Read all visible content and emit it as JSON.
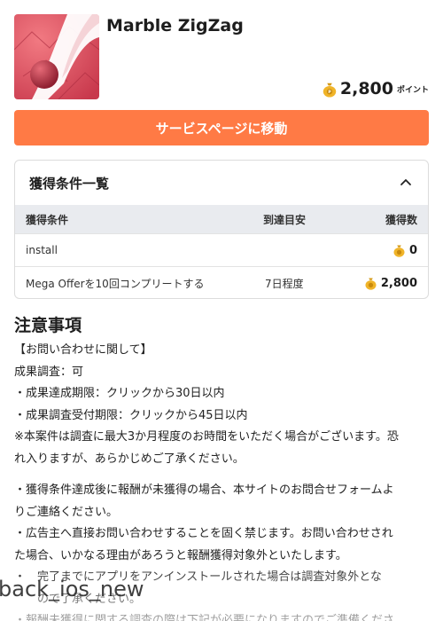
{
  "app": {
    "title": "Marble ZigZag",
    "icon_name": "marble-zigzag-app-icon",
    "points_value": "2,800",
    "points_unit": "ポイント"
  },
  "cta": {
    "label": "サービスページに移動"
  },
  "conditions": {
    "title": "獲得条件一覧",
    "headers": [
      "獲得条件",
      "到達目安",
      "獲得数"
    ],
    "rows": [
      {
        "condition": "install",
        "eta": "",
        "reward": "0"
      },
      {
        "condition": "Mega Offerを10回コンプリートする",
        "eta": "7日程度",
        "reward": "2,800"
      }
    ]
  },
  "notes": {
    "title": "注意事項",
    "lines": [
      "【お問い合わせに関して】",
      "成果調査：可",
      "・成果達成期限：クリックから30日以内",
      "・成果調査受付期限：クリックから45日以内",
      "※本案件は調査に最大3か月程度のお時間をいただく場合がございます。恐",
      "れ入りますが、あらかじめご了承ください。",
      "",
      "・獲得条件達成後に報酬が未獲得の場合、本サイトのお問合せフォームよ",
      "りご連絡ください。",
      "・広告主へ直接お問い合わせすることを固く禁じます。お問い合わせされ",
      "た場合、いかなる理由があろうと報酬獲得対象外といたします。",
      "・　完了までにアプリをアンインストールされた場合は調査対象外とな",
      "　　ので了承ください。",
      "・報酬未獲得に関する調査の際は下記が必要になりますのでご準備くださ"
    ]
  },
  "overlay": {
    "text": "back_ios_new"
  },
  "colors": {
    "accent": "#ff7a45",
    "table_header_bg": "#e9ebef"
  }
}
